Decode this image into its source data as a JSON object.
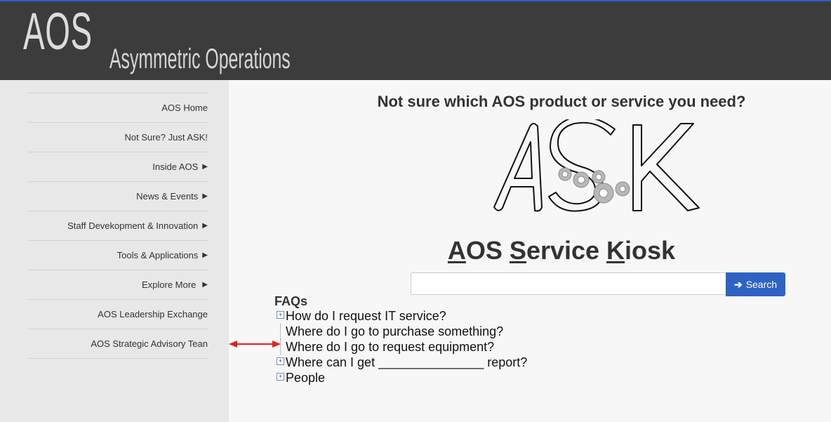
{
  "header": {
    "logo_abbr": "AOS",
    "logo_full": "Asymmetric Operations"
  },
  "sidebar": {
    "items": [
      {
        "label": "AOS Home",
        "has_arrow": false
      },
      {
        "label": "Not Sure? Just ASK!",
        "has_arrow": false
      },
      {
        "label": "Inside AOS",
        "has_arrow": true
      },
      {
        "label": "News & Events",
        "has_arrow": true
      },
      {
        "label": "Staff Devekopment & Innovation",
        "has_arrow": true
      },
      {
        "label": "Tools & Applications",
        "has_arrow": true
      },
      {
        "label": "Explore More",
        "has_arrow": true
      },
      {
        "label": "AOS Leadership Exchange",
        "has_arrow": false
      },
      {
        "label": "AOS Strategic Advisory Tean",
        "has_arrow": false
      }
    ],
    "arrow_glyph": "▶"
  },
  "main": {
    "question": "Not sure which AOS product or service you need?",
    "ask_logo_text": "ASK",
    "kiosk_title_parts": [
      "A",
      "OS ",
      "S",
      "ervice ",
      "K",
      "iosk"
    ],
    "search": {
      "value": "",
      "button_label": "Search"
    },
    "faq_title": "FAQs",
    "faq_items": [
      {
        "label": "How do I request IT service?",
        "expandable": true
      },
      {
        "label": "Where do I go to purchase something?",
        "expandable": false
      },
      {
        "label": "Where do I go to request equipment?",
        "expandable": false
      },
      {
        "label": "Where can I get _______________ report?",
        "expandable": true
      },
      {
        "label": "People",
        "expandable": true
      }
    ]
  },
  "colors": {
    "header_bg": "#3c3c3c",
    "sidebar_bg": "#e8e8e8",
    "search_button": "#2f63c3",
    "annotation_arrow": "#e02020"
  }
}
